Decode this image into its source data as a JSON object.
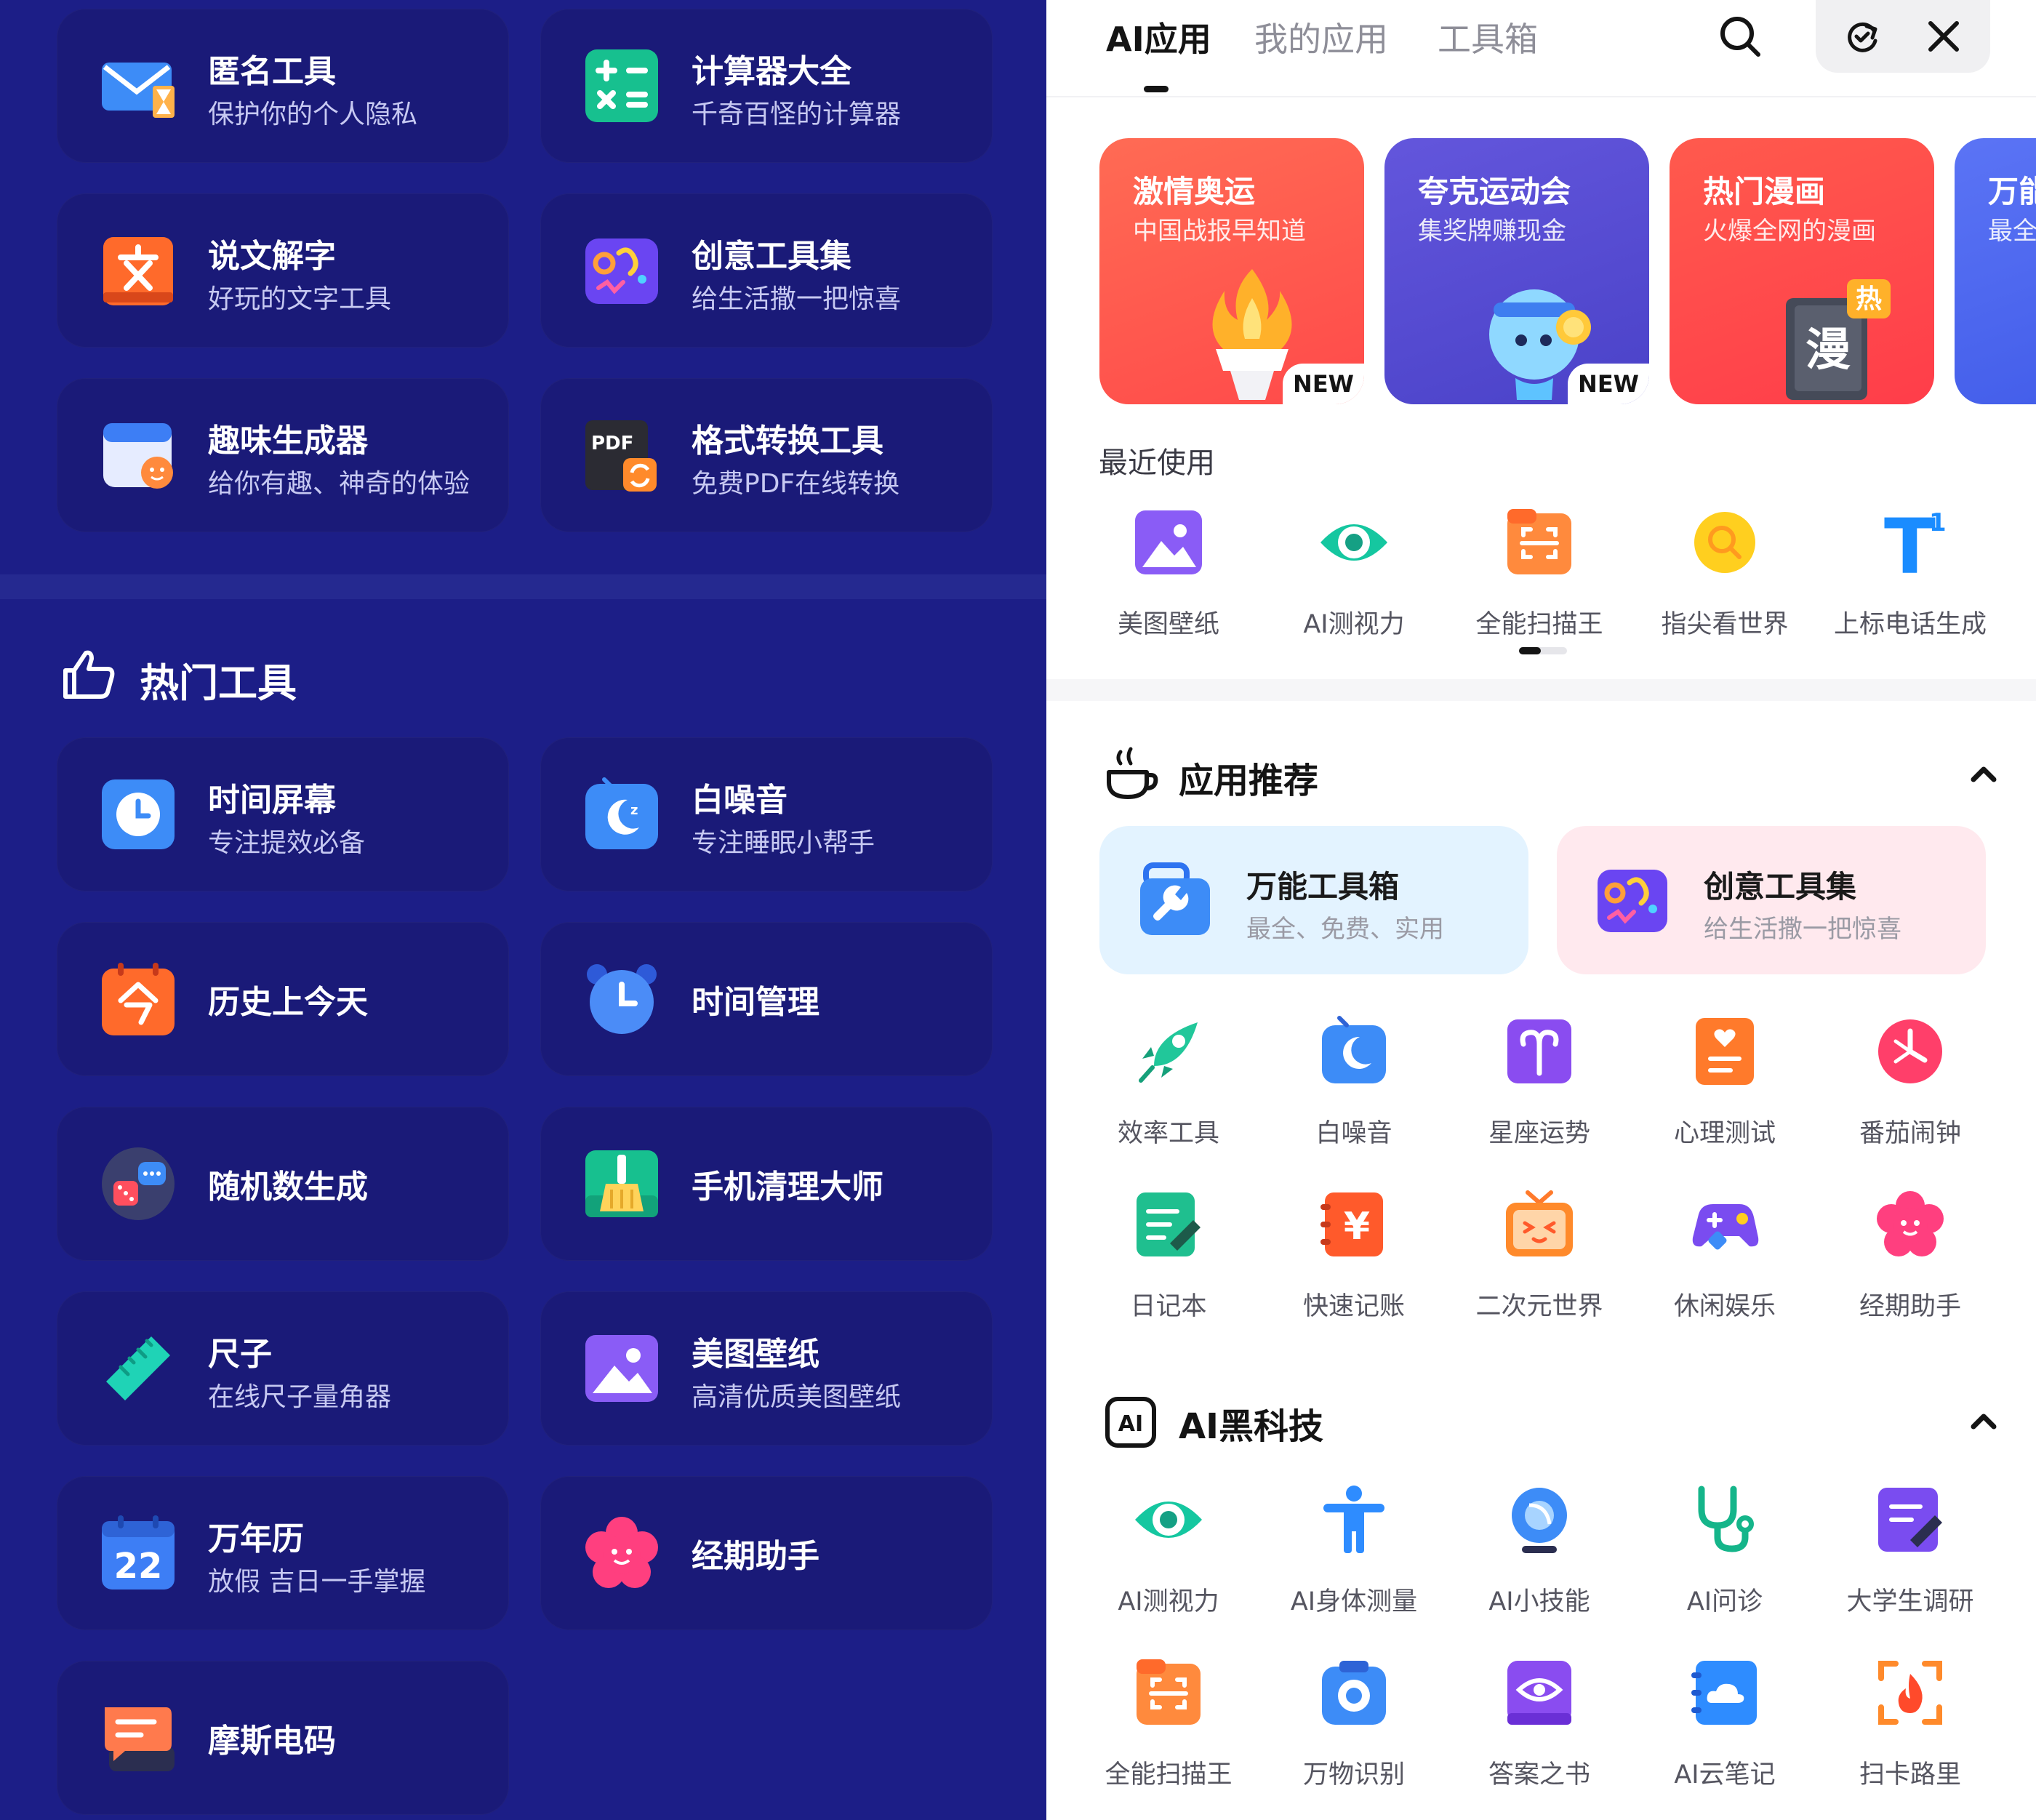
{
  "left_panel": {
    "tools_top": [
      {
        "title": "匿名工具",
        "subtitle": "保护你的个人隐私",
        "icon": "mail-hourglass-icon"
      },
      {
        "title": "计算器大全",
        "subtitle": "千奇百怪的计算器",
        "icon": "calculator-icon"
      },
      {
        "title": "说文解字",
        "subtitle": "好玩的文字工具",
        "icon": "character-book-icon"
      },
      {
        "title": "创意工具集",
        "subtitle": "给生活撒一把惊喜",
        "icon": "creative-palette-icon"
      },
      {
        "title": "趣味生成器",
        "subtitle": "给你有趣、神奇的体验",
        "icon": "fun-generator-icon"
      },
      {
        "title": "格式转换工具",
        "subtitle": "免费PDF在线转换",
        "icon": "pdf-convert-icon"
      }
    ],
    "hot_section": {
      "title": "热门工具",
      "icon": "thumbs-up-icon"
    },
    "tools_hot": [
      {
        "title": "时间屏幕",
        "subtitle": "专注提效必备",
        "icon": "clock-screen-icon"
      },
      {
        "title": "白噪音",
        "subtitle": "专注睡眠小帮手",
        "icon": "moon-sound-icon"
      },
      {
        "title": "历史上今天",
        "subtitle": "",
        "icon": "calendar-today-icon"
      },
      {
        "title": "时间管理",
        "subtitle": "",
        "icon": "alarm-clock-icon"
      },
      {
        "title": "随机数生成",
        "subtitle": "",
        "icon": "dice-icon"
      },
      {
        "title": "手机清理大师",
        "subtitle": "",
        "icon": "broom-icon"
      },
      {
        "title": "尺子",
        "subtitle": "在线尺子量角器",
        "icon": "ruler-icon"
      },
      {
        "title": "美图壁纸",
        "subtitle": "高清优质美图壁纸",
        "icon": "image-icon"
      },
      {
        "title": "万年历",
        "subtitle": "放假 吉日一手掌握",
        "icon": "calendar-22-icon",
        "badge": "22"
      },
      {
        "title": "经期助手",
        "subtitle": "",
        "icon": "flower-face-icon"
      },
      {
        "title": "摩斯电码",
        "subtitle": "",
        "icon": "chat-code-icon"
      }
    ]
  },
  "right_panel": {
    "tabs": [
      {
        "label": "AI应用",
        "active": true
      },
      {
        "label": "我的应用",
        "active": false
      },
      {
        "label": "工具箱",
        "active": false
      }
    ],
    "banners": [
      {
        "title": "激情奥运",
        "subtitle": "中国战报早知道",
        "new": "NEW",
        "color": "#ff5a4d"
      },
      {
        "title": "夸克运动会",
        "subtitle": "集奖牌赚现金",
        "new": "NEW",
        "color": "#5a50d6"
      },
      {
        "title": "热门漫画",
        "subtitle": "火爆全网的漫画",
        "badge": "热",
        "badge_char": "漫",
        "color": "#ff4a4a"
      },
      {
        "title": "万能",
        "subtitle": "最全",
        "color": "#4b67f0"
      }
    ],
    "recent": {
      "label": "最近使用",
      "items": [
        {
          "label": "美图壁纸",
          "icon": "image-icon"
        },
        {
          "label": "AI测视力",
          "icon": "eye-icon"
        },
        {
          "label": "全能扫描王",
          "icon": "scan-icon"
        },
        {
          "label": "指尖看世界",
          "icon": "magnifier-icon"
        },
        {
          "label": "上标电话生成",
          "icon": "superscript-icon",
          "glyph": "T",
          "sup": "1"
        }
      ]
    },
    "recommend": {
      "title": "应用推荐",
      "cards": [
        {
          "title": "万能工具箱",
          "subtitle": "最全、免费、实用",
          "icon": "toolbox-icon",
          "bg": "#e3f3ff"
        },
        {
          "title": "创意工具集",
          "subtitle": "给生活撒一把惊喜",
          "icon": "creative-palette-icon",
          "bg": "#ffe9ee"
        }
      ],
      "grid": [
        {
          "label": "效率工具",
          "icon": "rocket-icon"
        },
        {
          "label": "白噪音",
          "icon": "moon-sound-icon"
        },
        {
          "label": "星座运势",
          "icon": "aries-icon"
        },
        {
          "label": "心理测试",
          "icon": "heart-test-icon"
        },
        {
          "label": "番茄闹钟",
          "icon": "tomato-clock-icon"
        },
        {
          "label": "日记本",
          "icon": "diary-icon"
        },
        {
          "label": "快速记账",
          "icon": "ledger-icon",
          "glyph": "¥"
        },
        {
          "label": "二次元世界",
          "icon": "tv-face-icon"
        },
        {
          "label": "休闲娱乐",
          "icon": "gamepad-icon"
        },
        {
          "label": "经期助手",
          "icon": "flower-face-icon"
        }
      ]
    },
    "ai_tech": {
      "title": "AI黑科技",
      "icon_text": "AI",
      "grid": [
        {
          "label": "AI测视力",
          "icon": "eye-icon"
        },
        {
          "label": "AI身体测量",
          "icon": "body-measure-icon"
        },
        {
          "label": "AI小技能",
          "icon": "lens-icon"
        },
        {
          "label": "AI问诊",
          "icon": "stethoscope-icon"
        },
        {
          "label": "大学生调研",
          "icon": "survey-icon"
        },
        {
          "label": "全能扫描王",
          "icon": "scan-icon"
        },
        {
          "label": "万物识别",
          "icon": "camera-icon"
        },
        {
          "label": "答案之书",
          "icon": "answer-book-icon"
        },
        {
          "label": "AI云笔记",
          "icon": "cloud-note-icon"
        },
        {
          "label": "扫卡路里",
          "icon": "flame-scan-icon"
        }
      ]
    }
  }
}
